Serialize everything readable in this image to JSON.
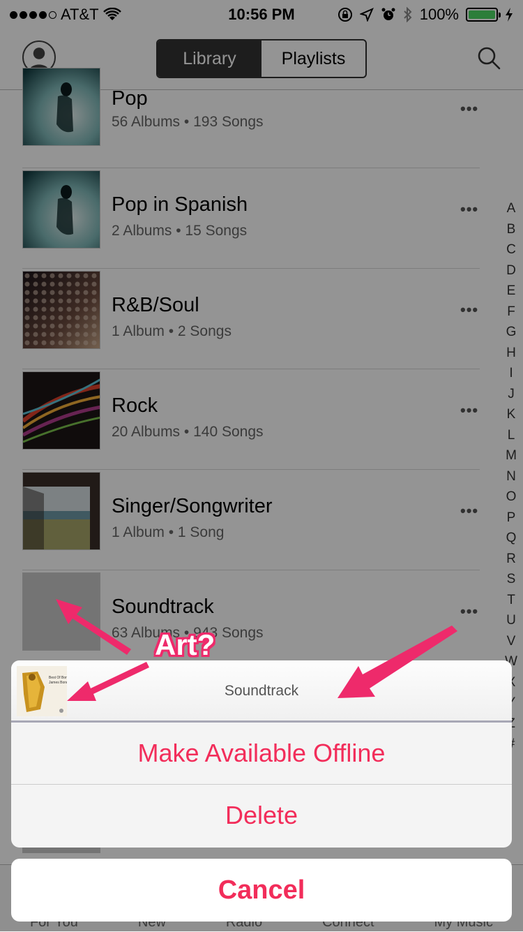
{
  "status_bar": {
    "carrier": "AT&T",
    "time": "10:56 PM",
    "battery": "100%"
  },
  "nav": {
    "segments": [
      "Library",
      "Playlists"
    ],
    "active_segment": "Library"
  },
  "genres": [
    {
      "title": "Pop",
      "subtitle": "56 Albums • 193 Songs",
      "more": "•••"
    },
    {
      "title": "Pop in Spanish",
      "subtitle": "2 Albums • 15 Songs",
      "more": "•••"
    },
    {
      "title": "R&B/Soul",
      "subtitle": "1 Album • 2 Songs",
      "more": "•••"
    },
    {
      "title": "Rock",
      "subtitle": "20 Albums • 140 Songs",
      "more": "•••"
    },
    {
      "title": "Singer/Songwriter",
      "subtitle": "1 Album • 1 Song",
      "more": "•••"
    },
    {
      "title": "Soundtrack",
      "subtitle": "63 Albums • 943 Songs",
      "more": "•••"
    }
  ],
  "index_letters": [
    "A",
    "B",
    "C",
    "D",
    "E",
    "F",
    "G",
    "H",
    "I",
    "J",
    "K",
    "L",
    "M",
    "N",
    "O",
    "P",
    "Q",
    "R",
    "S",
    "T",
    "U",
    "V",
    "W",
    "X",
    "Y",
    "Z",
    "#"
  ],
  "tab_bar": [
    "For You",
    "New",
    "Radio",
    "Connect",
    "My Music"
  ],
  "action_sheet": {
    "header": "Soundtrack",
    "art_text": "Best Of Bond... James Bond",
    "actions": [
      "Make Available Offline",
      "Delete"
    ],
    "cancel": "Cancel"
  },
  "annotation": {
    "label": "Art?",
    "color": "#ee2a6b"
  }
}
